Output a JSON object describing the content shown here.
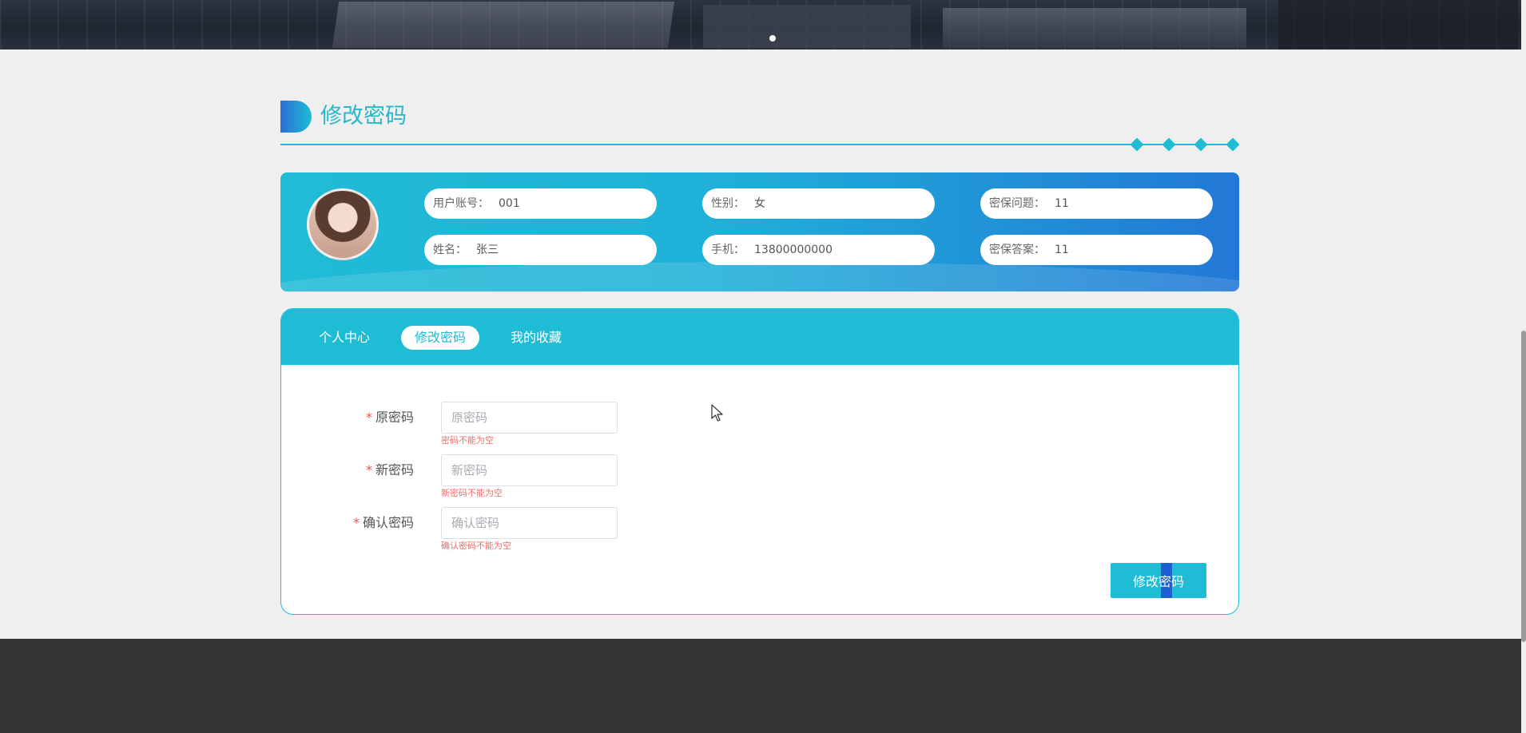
{
  "banner": {
    "carousel_dots": 1
  },
  "title": {
    "text": "修改密码"
  },
  "profile": {
    "fields": [
      {
        "label": "用户账号：",
        "value": "001"
      },
      {
        "label": "性别：",
        "value": "女"
      },
      {
        "label": "密保问题：",
        "value": "11"
      },
      {
        "label": "姓名：",
        "value": "张三"
      },
      {
        "label": "手机：",
        "value": "13800000000"
      },
      {
        "label": "密保答案：",
        "value": "11"
      }
    ]
  },
  "tabs": [
    {
      "label": "个人中心",
      "active": false
    },
    {
      "label": "修改密码",
      "active": true
    },
    {
      "label": "我的收藏",
      "active": false
    }
  ],
  "form": {
    "old_password": {
      "label": "原密码",
      "placeholder": "原密码",
      "error": "密码不能为空"
    },
    "new_password": {
      "label": "新密码",
      "placeholder": "新密码",
      "error": "新密码不能为空"
    },
    "confirm_password": {
      "label": "确认密码",
      "placeholder": "确认密码",
      "error": "确认密码不能为空"
    },
    "required_mark": "*",
    "submit_label": "修改密码"
  },
  "colors": {
    "accent": "#1fbcd5",
    "accent_dark": "#2278d6",
    "error": "#f56c6c",
    "footer": "#333333",
    "background": "#efefef"
  },
  "icons": {
    "title_badge": "half-circle-badge-icon",
    "divider_ornament": "diamond-icon",
    "cursor": "mouse-pointer-icon"
  }
}
